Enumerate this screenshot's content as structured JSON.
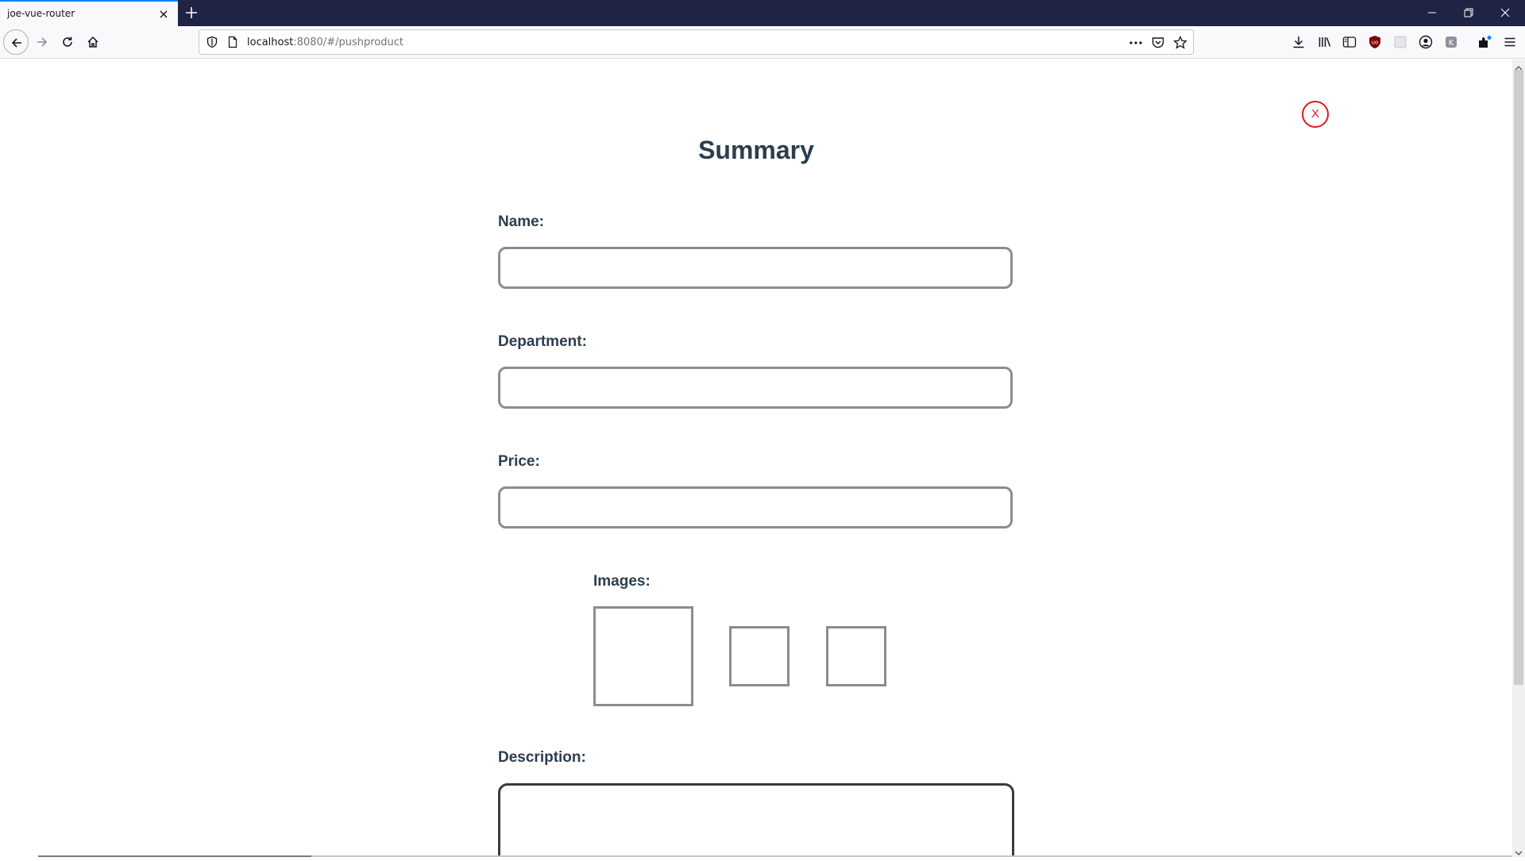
{
  "browser": {
    "tab_title": "joe-vue-router",
    "url_host": "localhost",
    "url_rest": ":8080/#/pushproduct",
    "accent": "#0a84ff",
    "titlebar_color": "#1f2344"
  },
  "page": {
    "close_label": "X",
    "title": "Summary",
    "fields": {
      "name_label": "Name:",
      "department_label": "Department:",
      "price_label": "Price:",
      "images_label": "Images:",
      "description_label": "Description:"
    },
    "close_color": "#e0191f",
    "heading_color": "#2c3e50"
  },
  "icons": {
    "tab_close": "close-icon",
    "new_tab": "plus-icon",
    "back": "arrow-left-icon",
    "forward": "arrow-right-icon",
    "reload": "reload-icon",
    "home": "home-icon",
    "tracking": "shield-icon",
    "page_info": "page-icon",
    "more": "ellipsis-icon",
    "pocket": "pocket-icon",
    "bookmark": "star-icon",
    "downloads": "download-icon",
    "library": "library-icon",
    "sidebar": "sidebar-icon",
    "ublock": "ublock-icon",
    "extension": "extension-icon",
    "account": "account-icon",
    "extension2": "extension-icon",
    "extensions": "puzzle-icon",
    "menu": "hamburger-menu-icon"
  }
}
